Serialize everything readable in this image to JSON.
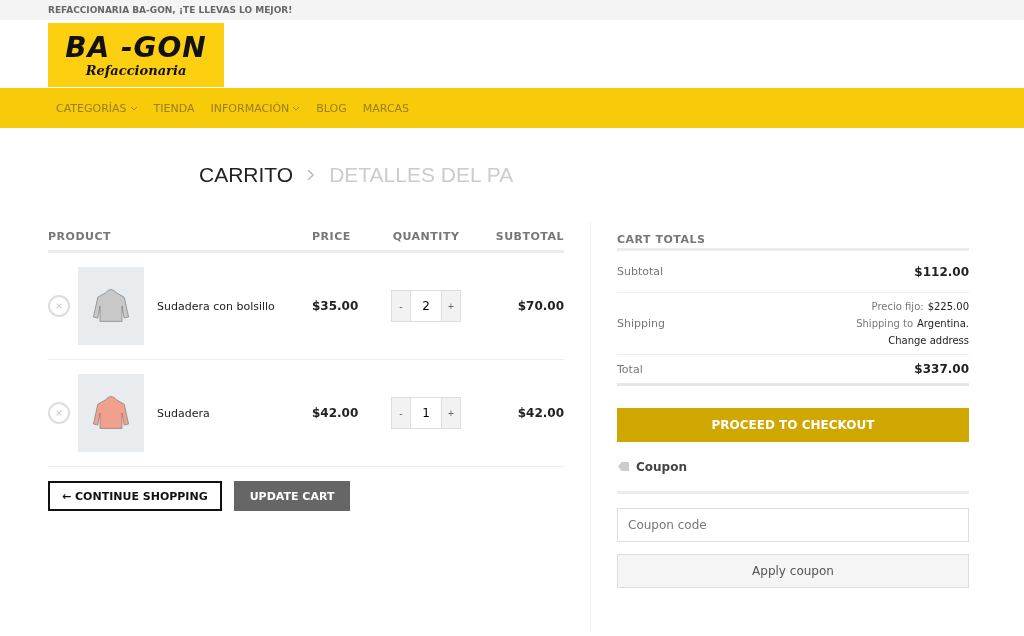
{
  "top_bar": {
    "text": "REFACCIONARIA BA-GON, ¡TE LLEVAS LO MEJOR!"
  },
  "logo": {
    "title": "BA -GON",
    "subtitle": "Refaccionaria"
  },
  "nav": [
    {
      "label": "CATEGORÍAS",
      "dropdown": true
    },
    {
      "label": "TIENDA",
      "dropdown": false
    },
    {
      "label": "INFORMACIÓN",
      "dropdown": true
    },
    {
      "label": "BLOG",
      "dropdown": false
    },
    {
      "label": "MARCAS",
      "dropdown": false
    }
  ],
  "breadcrumb": [
    {
      "label": "CARRITO",
      "selected": true
    },
    {
      "label": "DETALLES DEL PA",
      "selected": false
    }
  ],
  "cart": {
    "columns": [
      "PRODUCT",
      "PRICE",
      "QUANTITY",
      "SUBTOTAL"
    ],
    "rows": [
      {
        "name": "Sudadera con bolsillo",
        "color": "#c8c8c8",
        "price": "$35.00",
        "minus": "-",
        "quantity": "2",
        "plus": "+",
        "subtotal": "$70.00"
      },
      {
        "name": "Sudadera",
        "color": "#f0a08c",
        "price": "$42.00",
        "minus": "-",
        "quantity": "1",
        "plus": "+",
        "subtotal": "$42.00"
      }
    ],
    "continue_button": "← CONTINUE SHOPPING",
    "update_button": "UPDATE CART"
  },
  "totals": {
    "title": "CART TOTALS",
    "subtotal_label": "Subtotal",
    "subtotal": "$112.00",
    "shipping_label": "Shipping",
    "shipping_rate_label": "Precio fijo:",
    "shipping_rate": "$225.00",
    "shipping_to": "Shipping to",
    "shipping_country": "Argentina.",
    "change_address": "Change address",
    "total_label": "Total",
    "total": "$337.00",
    "checkout_button": "PROCEED TO CHECKOUT",
    "coupon_title": "Coupon",
    "coupon_placeholder": "Coupon code",
    "apply_button": "Apply coupon"
  }
}
